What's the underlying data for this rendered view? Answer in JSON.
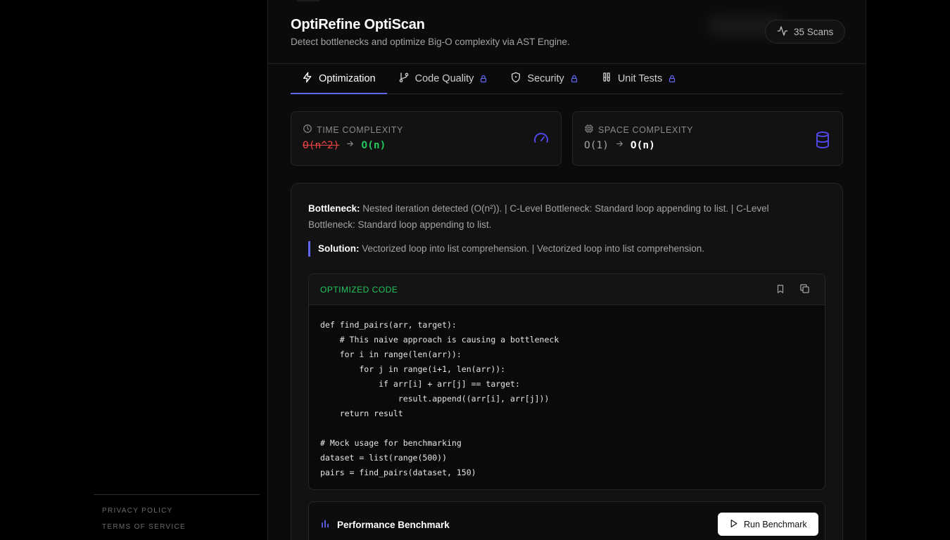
{
  "sidebar": {
    "footer_links": [
      "PRIVACY POLICY",
      "TERMS OF SERVICE"
    ]
  },
  "header": {
    "title": "OptiRefine OptiScan",
    "subtitle": "Detect bottlenecks and optimize Big-O complexity via AST Engine.",
    "scans_label": "35 Scans"
  },
  "tabs": [
    {
      "label": "Optimization",
      "icon": "bolt-icon",
      "active": true,
      "locked": false
    },
    {
      "label": "Code Quality",
      "icon": "git-branch-icon",
      "active": false,
      "locked": true
    },
    {
      "label": "Security",
      "icon": "shield-icon",
      "active": false,
      "locked": true
    },
    {
      "label": "Unit Tests",
      "icon": "test-tubes-icon",
      "active": false,
      "locked": true
    }
  ],
  "complexity": {
    "time": {
      "label": "TIME COMPLEXITY",
      "from": "O(n^2)",
      "to": "O(n)"
    },
    "space": {
      "label": "SPACE COMPLEXITY",
      "from": "O(1)",
      "to": "O(n)"
    }
  },
  "analysis": {
    "bottleneck_label": "Bottleneck:",
    "bottleneck_text": "Nested iteration detected (O(n²)). | C-Level Bottleneck: Standard loop appending to list. | C-Level Bottleneck: Standard loop appending to list.",
    "solution_label": "Solution:",
    "solution_text": "Vectorized loop into list comprehension. | Vectorized loop into list comprehension.",
    "code_label": "OPTIMIZED CODE",
    "code": "def find_pairs(arr, target):\n    # This naive approach is causing a bottleneck\n    for i in range(len(arr)):\n        for j in range(i+1, len(arr)):\n            if arr[i] + arr[j] == target:\n                result.append((arr[i], arr[j]))\n    return result\n\n# Mock usage for benchmarking\ndataset = list(range(500))\npairs = find_pairs(dataset, 150)"
  },
  "benchmark": {
    "title": "Performance Benchmark",
    "button_label": "Run Benchmark"
  },
  "colors": {
    "accent": "#6366f1",
    "bad": "#ef4444",
    "good": "#22c55e"
  }
}
